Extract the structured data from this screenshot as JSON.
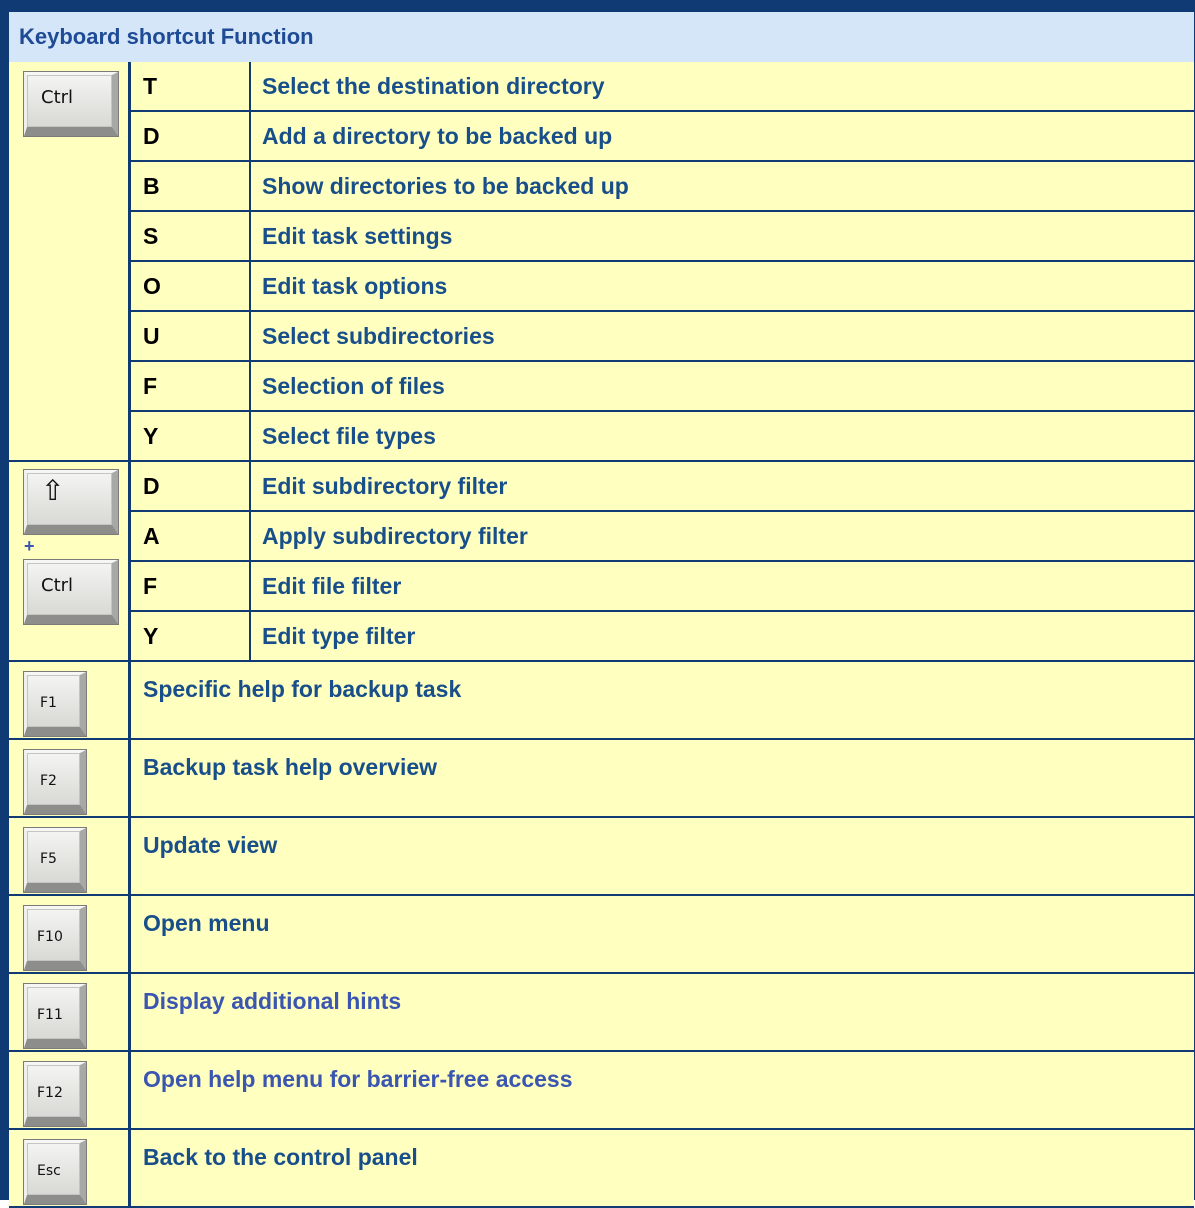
{
  "header": {
    "col_shortcut": "Keyboard shortcut",
    "col_function": "Function"
  },
  "ctrl_group": {
    "key_label": "Ctrl",
    "rows": [
      {
        "letter": "T",
        "function": "Select the destination directory"
      },
      {
        "letter": "D",
        "function": "Add a directory to be backed up"
      },
      {
        "letter": "B",
        "function": "Show directories to be backed up"
      },
      {
        "letter": "S",
        "function": "Edit task settings"
      },
      {
        "letter": "O",
        "function": "Edit task options"
      },
      {
        "letter": "U",
        "function": "Select subdirectories"
      },
      {
        "letter": "F",
        "function": "Selection of files"
      },
      {
        "letter": "Y",
        "function": "Select file types"
      }
    ]
  },
  "shift_ctrl_group": {
    "shift_key_glyph": "⇧",
    "plus": "+",
    "ctrl_key_label": "Ctrl",
    "rows": [
      {
        "letter": "D",
        "function": "Edit subdirectory filter"
      },
      {
        "letter": "A",
        "function": "Apply subdirectory filter"
      },
      {
        "letter": "F",
        "function": "Edit file filter"
      },
      {
        "letter": "Y",
        "function": "Edit type filter"
      }
    ]
  },
  "function_keys": [
    {
      "key": "F1",
      "function": "Specific help for backup task"
    },
    {
      "key": "F2",
      "function": "Backup task help overview"
    },
    {
      "key": "F5",
      "function": "Update view"
    },
    {
      "key": "F10",
      "function": "Open menu"
    },
    {
      "key": "F11",
      "function": "Display additional hints"
    },
    {
      "key": "F12",
      "function": "Open help menu for barrier-free access"
    },
    {
      "key": "Esc",
      "function": "Back to the control panel"
    }
  ],
  "colors": {
    "frame": "#0f3a73",
    "header_bg": "#d4e6f7",
    "row_bg": "#ffffc0",
    "function_text": "#184f8a",
    "hint_text": "#3a56b0"
  }
}
